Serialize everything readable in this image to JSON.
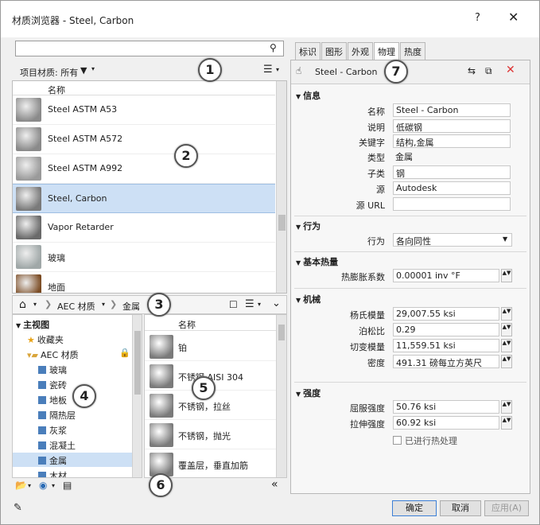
{
  "window": {
    "title": "材质浏览器 - Steel, Carbon",
    "help": "?",
    "close": "✕"
  },
  "search": {
    "placeholder": ""
  },
  "filter": {
    "label": "项目材质: 所有",
    "funnel": "⧩"
  },
  "list": {
    "header": "名称",
    "items": [
      {
        "label": "Steel ASTM A53",
        "color": "#8a8a8a"
      },
      {
        "label": "Steel ASTM A572",
        "color": "#8a8a8a"
      },
      {
        "label": "Steel ASTM A992",
        "color": "#9a9a9a"
      },
      {
        "label": "Steel, Carbon",
        "color": "#7a7a7a",
        "selected": true
      },
      {
        "label": "Vapor Retarder",
        "color": "#6a6a6a"
      },
      {
        "label": "玻璃",
        "color": "#a0a8a8"
      },
      {
        "label": "地面",
        "color": "#7a4a22"
      }
    ]
  },
  "breadcrumb": {
    "home": "⌂",
    "items": [
      "AEC 材质",
      "金属"
    ]
  },
  "tree": {
    "items": [
      {
        "label": "主视图",
        "level": 0,
        "kind": "root"
      },
      {
        "label": "收藏夹",
        "level": 1,
        "kind": "star"
      },
      {
        "label": "AEC 材质",
        "level": 1,
        "kind": "folder"
      },
      {
        "label": "玻璃",
        "level": 2,
        "kind": "leaf"
      },
      {
        "label": "瓷砖",
        "level": 2,
        "kind": "leaf"
      },
      {
        "label": "地板",
        "level": 2,
        "kind": "leaf"
      },
      {
        "label": "隔热层",
        "level": 2,
        "kind": "leaf"
      },
      {
        "label": "灰浆",
        "level": 2,
        "kind": "leaf"
      },
      {
        "label": "混凝土",
        "level": 2,
        "kind": "leaf"
      },
      {
        "label": "金属",
        "level": 2,
        "kind": "leaf",
        "selected": true
      },
      {
        "label": "木材",
        "level": 2,
        "kind": "leaf"
      }
    ]
  },
  "materials": {
    "header": "名称",
    "items": [
      "铂",
      "不锈钢 AISI 304",
      "不锈钢，拉丝",
      "不锈钢，抛光",
      "覆盖层，垂直加筋"
    ]
  },
  "tabs": [
    "标识",
    "图形",
    "外观",
    "物理",
    "热度"
  ],
  "active_tab": "物理",
  "asset": {
    "name": "Steel - Carbon"
  },
  "sections": {
    "info": {
      "title": "信息",
      "rows": [
        {
          "label": "名称",
          "value": "Steel - Carbon"
        },
        {
          "label": "说明",
          "value": "低碳钢"
        },
        {
          "label": "关键字",
          "value": "结构,金属"
        },
        {
          "label": "类型",
          "value": "金属"
        },
        {
          "label": "子类",
          "value": "钢"
        },
        {
          "label": "源",
          "value": "Autodesk"
        },
        {
          "label": "源 URL",
          "value": ""
        }
      ]
    },
    "behavior": {
      "title": "行为",
      "label": "行为",
      "value": "各向同性"
    },
    "thermal": {
      "title": "基本热量",
      "label": "热膨胀系数",
      "value": "0.00001 inv °F"
    },
    "mechanical": {
      "title": "机械",
      "rows": [
        {
          "label": "杨氏模量",
          "value": "29,007.55 ksi"
        },
        {
          "label": "泊松比",
          "value": "0.29"
        },
        {
          "label": "切变模量",
          "value": "11,559.51 ksi"
        },
        {
          "label": "密度",
          "value": "491.31 磅每立方英尺"
        }
      ]
    },
    "strength": {
      "title": "强度",
      "rows": [
        {
          "label": "屈服强度",
          "value": "50.76 ksi"
        },
        {
          "label": "拉伸强度",
          "value": "60.92 ksi"
        }
      ],
      "heat_treated": "已进行热处理"
    }
  },
  "buttons": {
    "ok": "确定",
    "cancel": "取消",
    "apply": "应用(A)"
  },
  "callouts": [
    "1",
    "2",
    "3",
    "4",
    "5",
    "6",
    "7"
  ]
}
